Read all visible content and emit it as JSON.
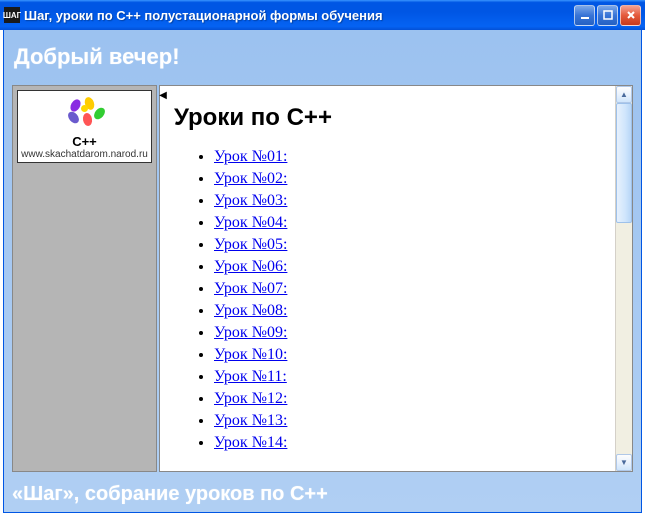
{
  "window": {
    "icon_text": "ШАГ",
    "title": "Шаг, уроки по C++ полустационарной формы обучения"
  },
  "header": {
    "greeting": "Добрый вечер!"
  },
  "sidebar": {
    "card": {
      "label": "C++",
      "url": "www.skachatdarom.narod.ru"
    }
  },
  "content": {
    "heading": "Уроки по С++",
    "lessons": [
      "Урок №01:",
      "Урок №02:",
      "Урок №03:",
      "Урок №04:",
      "Урок №05:",
      "Урок №06:",
      "Урок №07:",
      "Урок №08:",
      "Урок №09:",
      "Урок №10:",
      "Урок №11:",
      "Урок №12:",
      "Урок №13:",
      "Урок №14:"
    ]
  },
  "footer": {
    "text": "«Шаг», собрание уроков по C++"
  }
}
